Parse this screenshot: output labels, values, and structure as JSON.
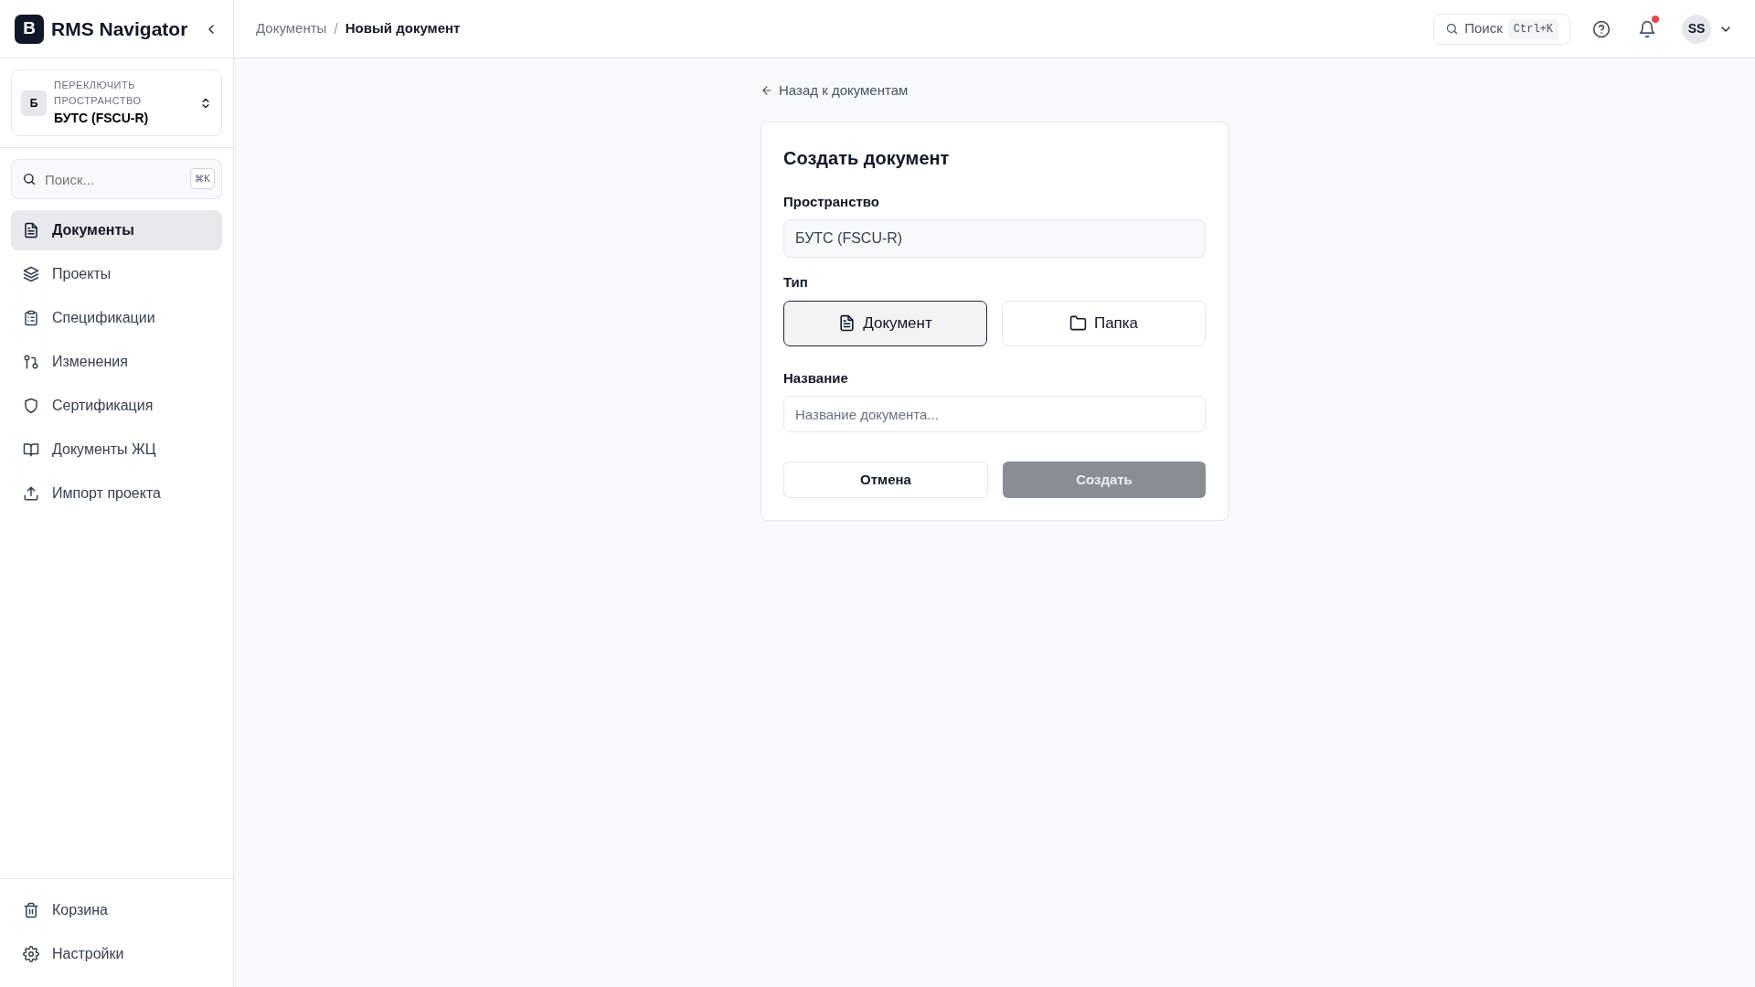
{
  "app": {
    "logo_letter": "B",
    "title": "RMS Navigator"
  },
  "breadcrumb_separator": "/",
  "breadcrumb": [
    {
      "label": "Документы",
      "current": false
    },
    {
      "label": "Новый документ",
      "current": true
    }
  ],
  "topbar": {
    "search": {
      "placeholder": "Поиск",
      "shortcut": "Ctrl+K"
    },
    "notifications_unread": true,
    "user_initials": "SS"
  },
  "workspace_switcher": {
    "letter": "Б",
    "caption": "ПЕРЕКЛЮЧИТЬ ПРОСТРАНСТВО",
    "name": "БУТС (FSCU-R)"
  },
  "sidebar_search": {
    "placeholder": "Поиск...",
    "shortcut": "⌘K"
  },
  "sidebar": {
    "items": [
      {
        "label": "Документы",
        "selected": true
      },
      {
        "label": "Проекты",
        "selected": false
      },
      {
        "label": "Спецификации",
        "selected": false
      },
      {
        "label": "Изменения",
        "selected": false
      },
      {
        "label": "Сертификация",
        "selected": false
      },
      {
        "label": "Документы ЖЦ",
        "selected": false
      },
      {
        "label": "Импорт проекта",
        "selected": false
      }
    ],
    "bottom_items": [
      {
        "label": "Корзина"
      },
      {
        "label": "Настройки"
      }
    ]
  },
  "back_link": "Назад к документам",
  "form": {
    "title": "Создать документ",
    "space_label": "Пространство",
    "space_value": "БУТС (FSCU-R)",
    "type_label": "Тип",
    "types": [
      {
        "label": "Документ",
        "selected": true
      },
      {
        "label": "Папка",
        "selected": false
      }
    ],
    "name_label": "Название",
    "name_placeholder": "Название документа...",
    "cancel": "Отмена",
    "submit": {
      "label": "Создать",
      "disabled": true
    }
  }
}
